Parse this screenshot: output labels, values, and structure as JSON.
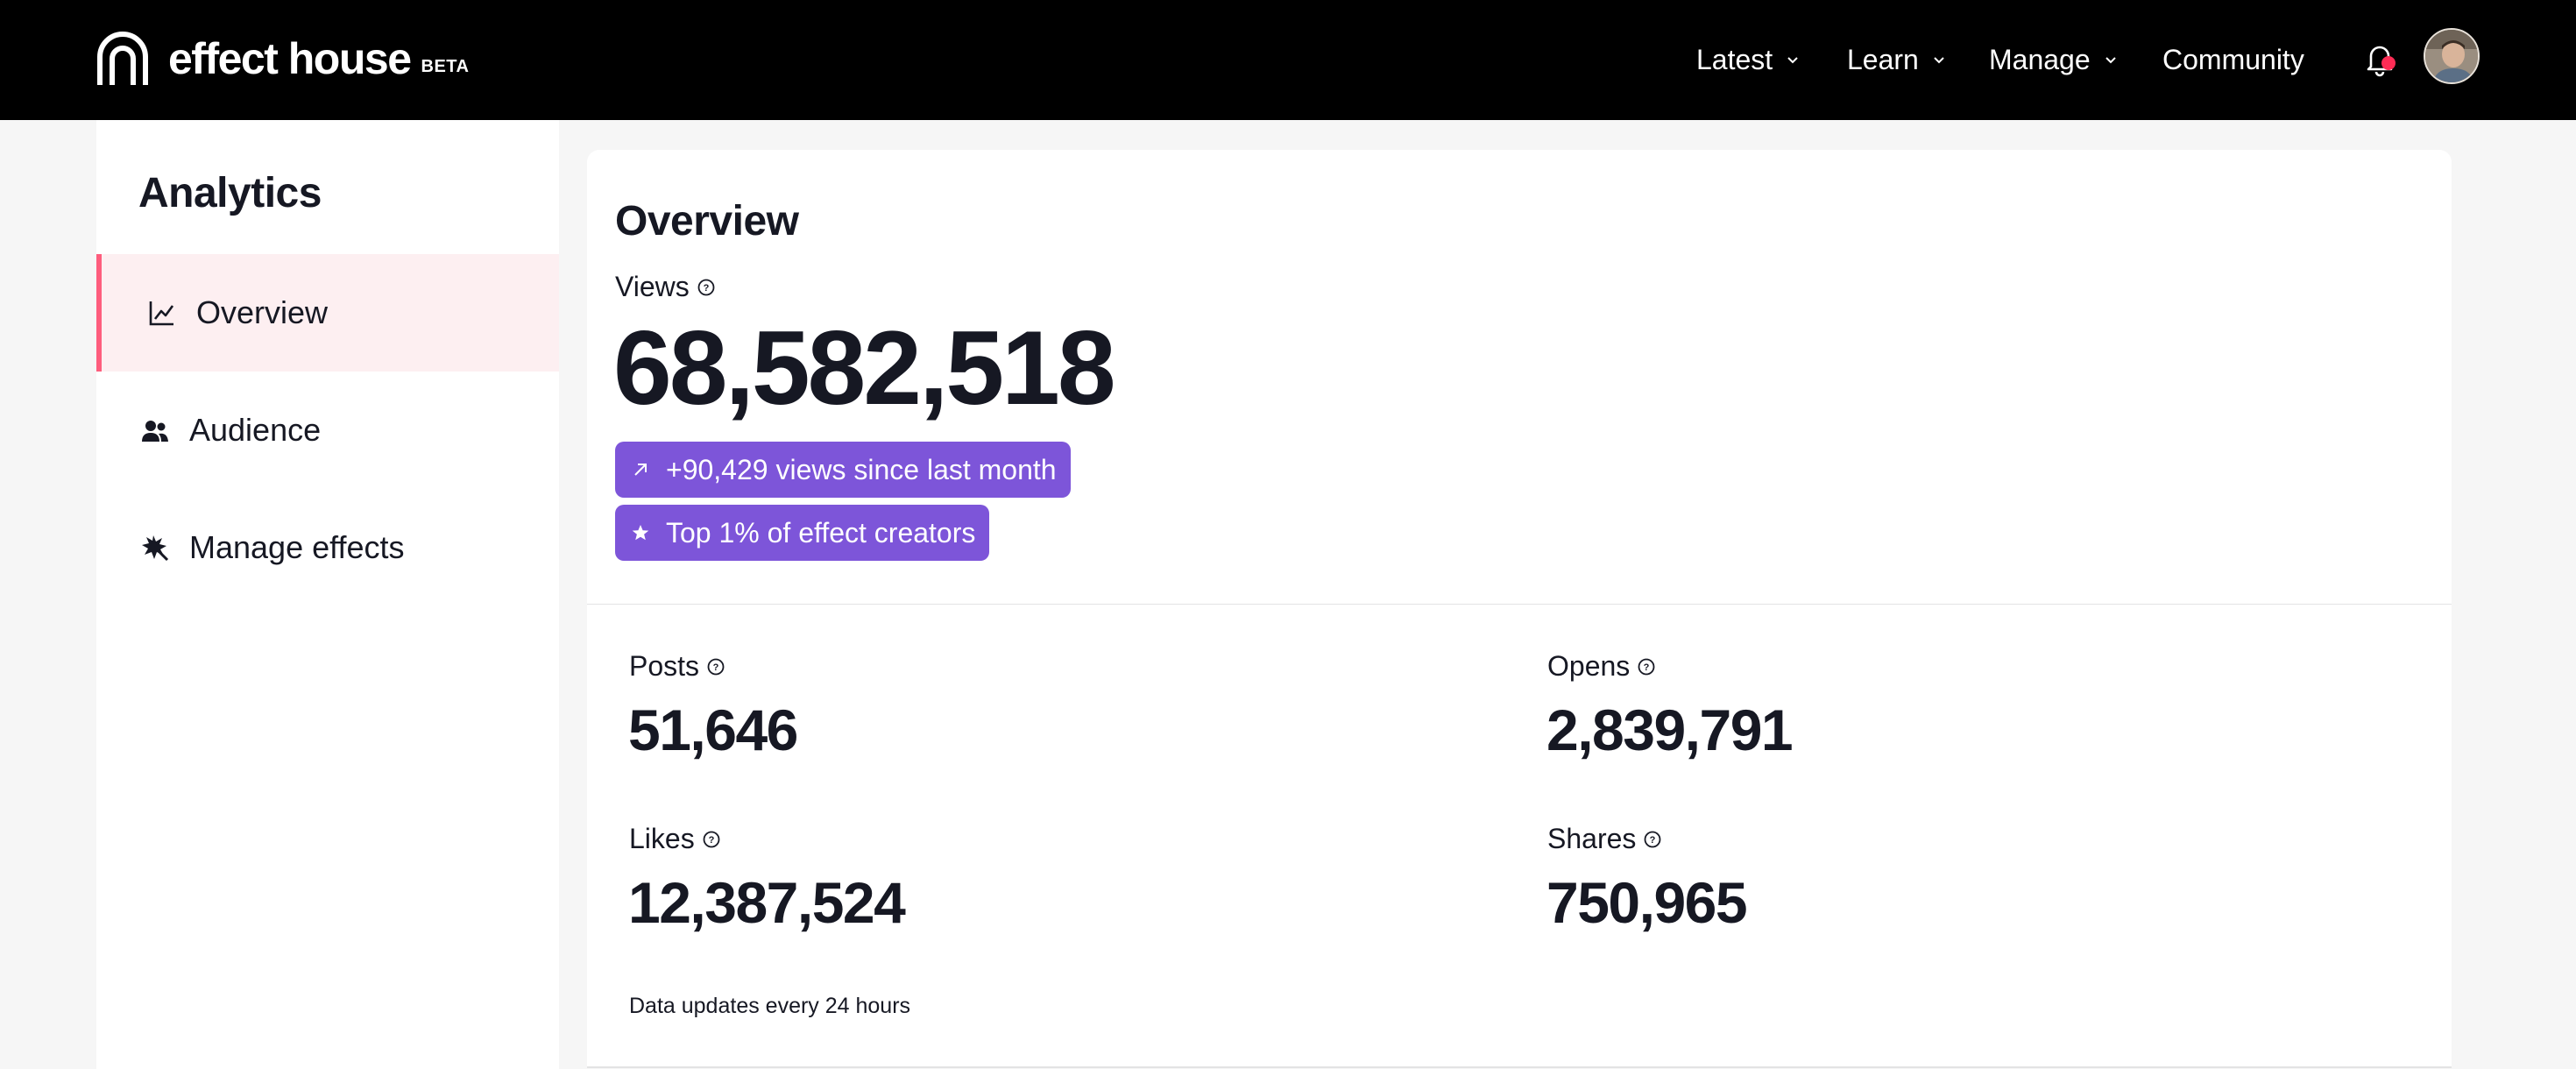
{
  "brand": {
    "name": "effect house",
    "badge": "BETA"
  },
  "nav": {
    "items": [
      {
        "label": "Latest",
        "dropdown": true
      },
      {
        "label": "Learn",
        "dropdown": true
      },
      {
        "label": "Manage",
        "dropdown": true
      },
      {
        "label": "Community",
        "dropdown": false
      }
    ],
    "icons": {
      "notifications": "bell-icon",
      "profile": "avatar"
    },
    "notification_dot_color": "#fe2c55"
  },
  "sidebar": {
    "title": "Analytics",
    "items": [
      {
        "label": "Overview",
        "icon": "line-chart-icon",
        "active": true
      },
      {
        "label": "Audience",
        "icon": "people-icon",
        "active": false
      },
      {
        "label": "Manage effects",
        "icon": "effects-icon",
        "active": false
      }
    ]
  },
  "overview": {
    "title": "Overview",
    "views_label": "Views",
    "views_value": "68,582,518",
    "badges": [
      {
        "icon": "arrow-up-right-icon",
        "text": "+90,429 views since last month"
      },
      {
        "icon": "star-icon",
        "text": "Top 1% of effect creators"
      }
    ],
    "stats": [
      {
        "label": "Posts",
        "value": "51,646"
      },
      {
        "label": "Opens",
        "value": "2,839,791"
      },
      {
        "label": "Likes",
        "value": "12,387,524"
      },
      {
        "label": "Shares",
        "value": "750,965"
      }
    ],
    "footnote": "Data updates every 24 hours"
  },
  "colors": {
    "accent": "#fe2c55",
    "badge": "#7d55d9",
    "topbar": "#000000",
    "active_bg": "#fdeff1"
  }
}
